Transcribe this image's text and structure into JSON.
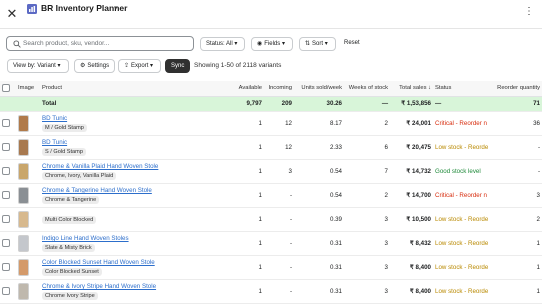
{
  "header": {
    "title": "BR Inventory Planner",
    "close_icon": "close-icon",
    "menu_icon": "kebab-menu-icon"
  },
  "search": {
    "placeholder": "Search product, sku, vendor...",
    "value": ""
  },
  "filters": {
    "status": "Status: All",
    "fields": "Fields",
    "sort": "Sort",
    "reset": "Reset"
  },
  "toolbar": {
    "view": "View by: Variant",
    "settings": "Settings",
    "export": "Export",
    "sync": "Sync",
    "showing": "Showing 1-50 of 2118 variants"
  },
  "columns": {
    "image": "Image",
    "product": "Product",
    "available": "Available",
    "incoming": "Incoming",
    "units_sold": "Units sold/week",
    "weeks_stock": "Weeks of stock",
    "total_sales": "Total sales ↓",
    "status": "Status",
    "reorder_qty": "Reorder quantity"
  },
  "total": {
    "label": "Total",
    "available": "9,797",
    "incoming": "209",
    "units_sold": "30.26",
    "weeks_stock": "—",
    "total_sales": "₹ 1,53,856",
    "status": "—",
    "reorder_qty": "71"
  },
  "rows": [
    {
      "name": "BD Tunic",
      "variant": "M / Gold Stamp",
      "available": "1",
      "incoming": "12",
      "units_sold": "8.17",
      "weeks_stock": "2",
      "total_sales": "₹ 24,001",
      "status": "Critical - Reorder n",
      "status_kind": "critical",
      "reorder_qty": "36",
      "thumb": "#b07a4a"
    },
    {
      "name": "BD Tunic",
      "variant": "S / Gold Stamp",
      "available": "1",
      "incoming": "12",
      "units_sold": "2.33",
      "weeks_stock": "6",
      "total_sales": "₹ 20,475",
      "status": "Low stock - Reorde",
      "status_kind": "low",
      "reorder_qty": "-",
      "thumb": "#a8794f"
    },
    {
      "name": "Chrome & Vanilla Plaid Hand Woven Stole",
      "variant": "Chrome, Ivory, Vanilla Plaid",
      "available": "1",
      "incoming": "3",
      "units_sold": "0.54",
      "weeks_stock": "7",
      "total_sales": "₹ 14,732",
      "status": "Good stock level",
      "status_kind": "good",
      "reorder_qty": "-",
      "thumb": "#c9a66b"
    },
    {
      "name": "Chrome & Tangerine Hand Woven Stole",
      "variant": "Chrome & Tangerine",
      "available": "1",
      "incoming": "-",
      "units_sold": "0.54",
      "weeks_stock": "2",
      "total_sales": "₹ 14,700",
      "status": "Critical - Reorder n",
      "status_kind": "critical",
      "reorder_qty": "3",
      "thumb": "#8a8f94"
    },
    {
      "name": "",
      "variant": "Multi Color Blocked",
      "available": "1",
      "incoming": "-",
      "units_sold": "0.39",
      "weeks_stock": "3",
      "total_sales": "₹ 10,500",
      "status": "Low stock - Reorde",
      "status_kind": "low",
      "reorder_qty": "2",
      "thumb": "#d7b98e"
    },
    {
      "name": "Indigo Line Hand Woven Stoles",
      "variant": "Slate & Misty Brick",
      "available": "1",
      "incoming": "-",
      "units_sold": "0.31",
      "weeks_stock": "3",
      "total_sales": "₹ 8,432",
      "status": "Low stock - Reorde",
      "status_kind": "low",
      "reorder_qty": "1",
      "thumb": "#c4c7cc"
    },
    {
      "name": "Color Blocked Sunset Hand Woven Stole",
      "variant": "Color Blocked Sunset",
      "available": "1",
      "incoming": "-",
      "units_sold": "0.31",
      "weeks_stock": "3",
      "total_sales": "₹ 8,400",
      "status": "Low stock - Reorde",
      "status_kind": "low",
      "reorder_qty": "1",
      "thumb": "#d49a6a"
    },
    {
      "name": "Chrome & Ivory Stripe Hand Woven Stole",
      "variant": "Chrome Ivory Stripe",
      "available": "1",
      "incoming": "-",
      "units_sold": "0.31",
      "weeks_stock": "3",
      "total_sales": "₹ 8,400",
      "status": "Low stock - Reorde",
      "status_kind": "low",
      "reorder_qty": "1",
      "thumb": "#bfb8ad"
    }
  ]
}
